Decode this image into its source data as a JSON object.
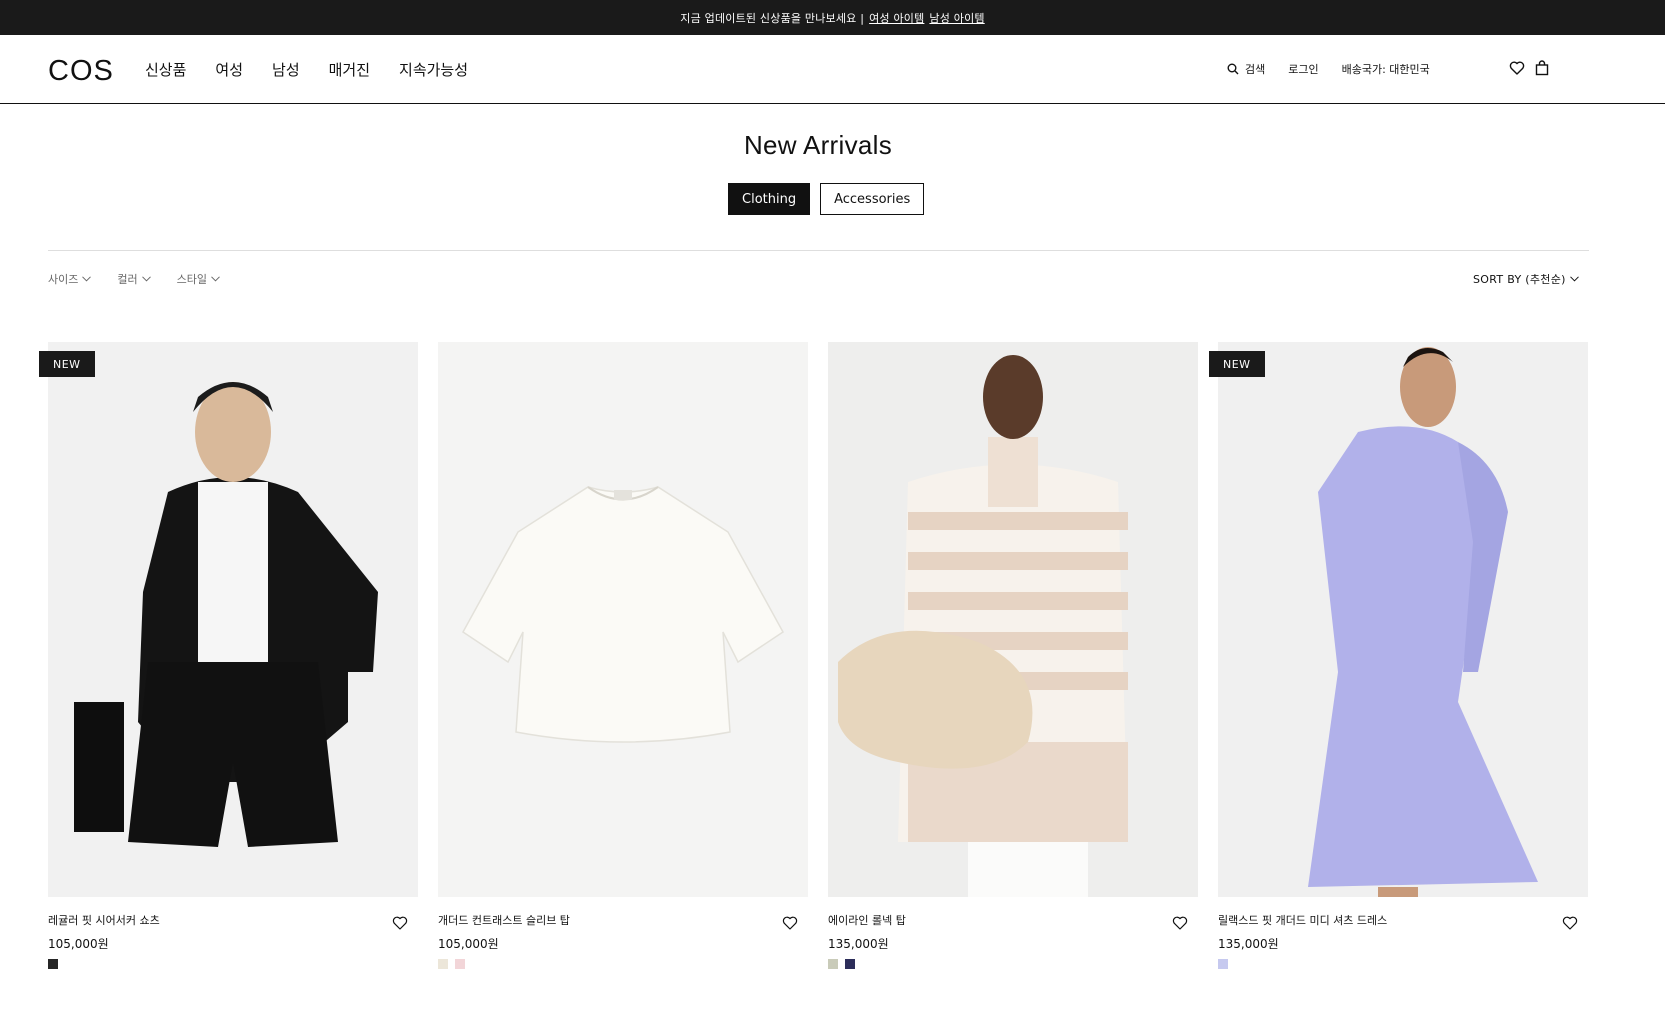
{
  "promo": {
    "text": "지금 업데이트된 신상품을 만나보세요 |",
    "link_women": "여성 아이템",
    "link_men": "남성 아이템"
  },
  "header": {
    "logo": "COS",
    "nav": [
      "신상품",
      "여성",
      "남성",
      "매거진",
      "지속가능성"
    ],
    "search_label": "검색",
    "login_label": "로그인",
    "shipping_label": "배송국가: 대한민국"
  },
  "page": {
    "title": "New Arrivals",
    "tabs": [
      {
        "label": "Clothing",
        "active": true
      },
      {
        "label": "Accessories",
        "active": false
      }
    ]
  },
  "filters": {
    "items": [
      "사이즈",
      "컬러",
      "스타일"
    ],
    "sort_label": "SORT BY (추천순)"
  },
  "products": [
    {
      "badge": "NEW",
      "name": "레귤러 핏 시어서커 쇼츠",
      "price": "105,000원",
      "swatches": [
        "#262626"
      ]
    },
    {
      "badge": "",
      "name": "개더드 컨트래스트 슬리브 탑",
      "price": "105,000원",
      "swatches": [
        "#ece6d9",
        "#f2d5d8"
      ]
    },
    {
      "badge": "",
      "name": "에이라인 롤넥 탑",
      "price": "135,000원",
      "swatches": [
        "#c9cbb9",
        "#2c2d5a"
      ]
    },
    {
      "badge": "NEW",
      "name": "릴랙스드 핏 개더드 미디 셔츠 드레스",
      "price": "135,000원",
      "swatches": [
        "#c6c9ef"
      ]
    }
  ]
}
